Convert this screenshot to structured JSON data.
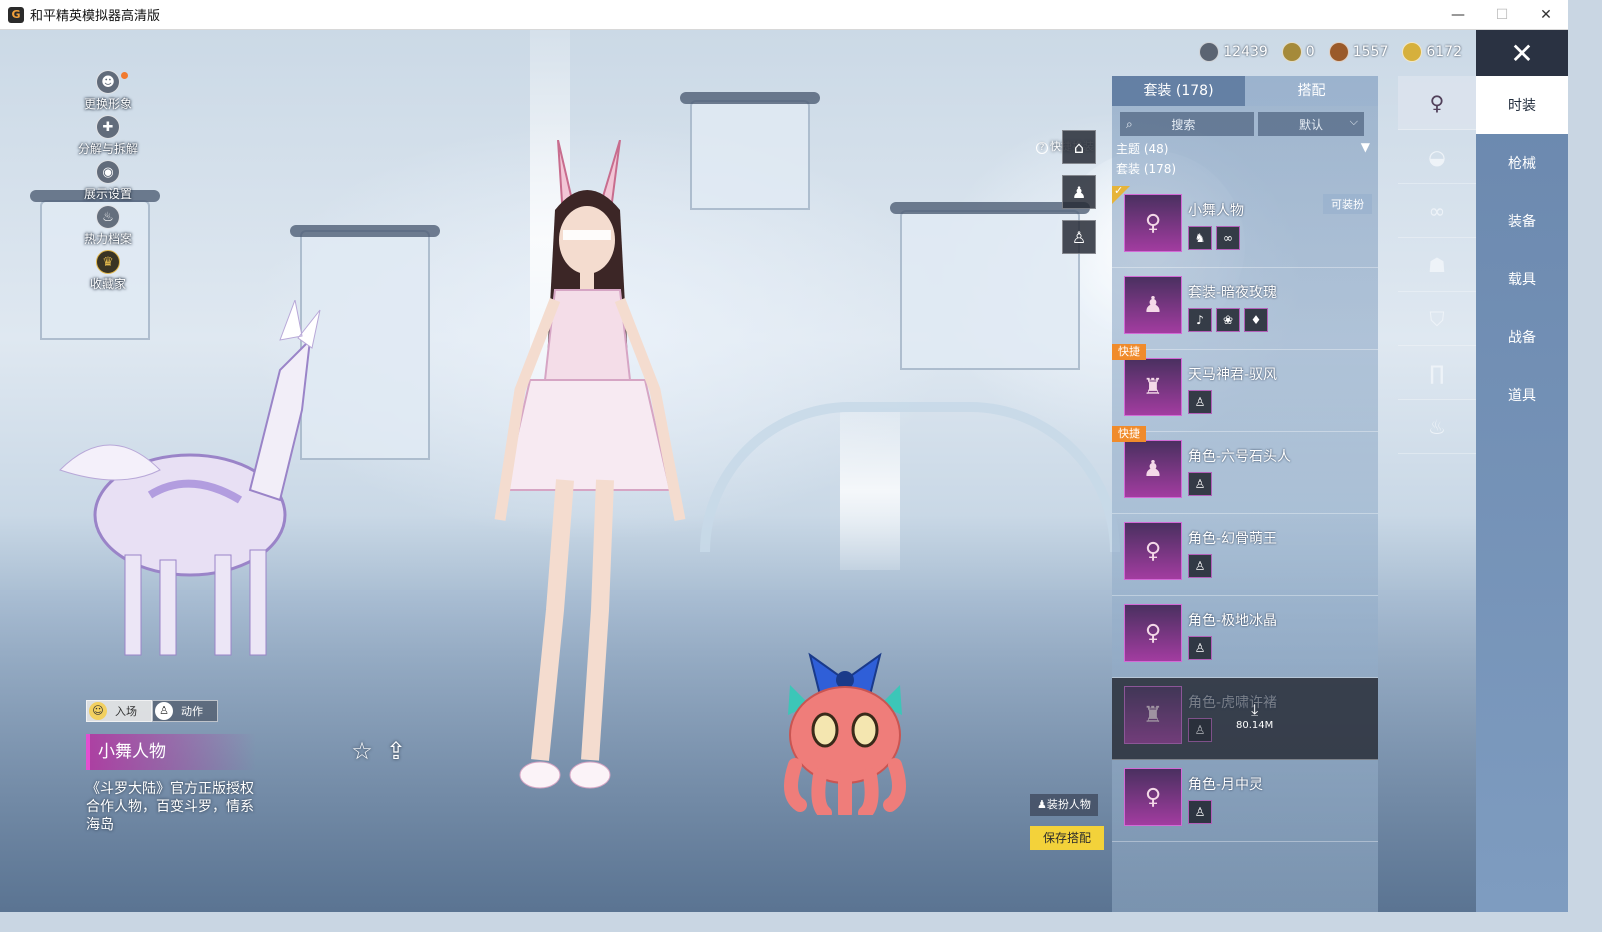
{
  "window": {
    "title": "和平精英模拟器高清版",
    "logo": "G",
    "minimize": "—",
    "maximize": "☐",
    "close": "✕"
  },
  "left_menu": [
    {
      "label": "更换形象",
      "icon": "avatar-icon",
      "glyph": "☻",
      "notify": true
    },
    {
      "label": "分解与拆解",
      "icon": "puzzle-icon",
      "glyph": "✚"
    },
    {
      "label": "展示设置",
      "icon": "eye-icon",
      "glyph": "◉"
    },
    {
      "label": "热力档案",
      "icon": "flame-icon",
      "glyph": "♨"
    },
    {
      "label": "收藏家",
      "icon": "collector-icon",
      "glyph": "♛",
      "gold": true
    }
  ],
  "emote_tabs": [
    {
      "label": "入场",
      "icon": "smile-icon",
      "glyph": "☺",
      "active": true
    },
    {
      "label": "动作",
      "icon": "pose-icon",
      "glyph": "♙",
      "active": false
    }
  ],
  "outfit": {
    "name": "小舞人物",
    "description": "《斗罗大陆》官方正版授权合作人物，百变斗罗，情系海岛",
    "favorite_icon": "star-outline-icon",
    "favorite_glyph": "☆",
    "share_icon": "share-icon",
    "share_glyph": "⇪"
  },
  "quick_swap": {
    "label": "快捷换装",
    "help_icon": "help-circle-icon",
    "help_glyph": "?",
    "slots": [
      {
        "icon": "hanger-icon",
        "glyph": "⌂"
      },
      {
        "icon": "outfit-slot-icon",
        "glyph": "♟"
      },
      {
        "icon": "outfit-slot-icon",
        "glyph": "♙"
      }
    ]
  },
  "currencies": [
    {
      "value": "12439",
      "icon": "silver-coin-icon",
      "color": "#5b6472"
    },
    {
      "value": "0",
      "icon": "gold-coin-icon",
      "color": "#a58a3a"
    },
    {
      "value": "1557",
      "icon": "bronze-coin-icon",
      "color": "#9a5a2a"
    },
    {
      "value": "6172",
      "icon": "star-coin-icon",
      "color": "#d6b03c"
    }
  ],
  "inventory": {
    "tabs": [
      {
        "label": "套装 (178)",
        "active": true
      },
      {
        "label": "搭配",
        "active": false
      }
    ],
    "search_placeholder": "搜索",
    "search_icon": "search-icon",
    "search_glyph": "⌕",
    "sort_label": "默认",
    "sort_chevron": "⌵",
    "categories": [
      {
        "label": "主题 (48)",
        "arrow": "▼"
      },
      {
        "label": "套装 (178)",
        "arrow": ""
      }
    ],
    "items": [
      {
        "name": "小舞人物",
        "thumb": "♀",
        "parts": [
          "♞",
          "∞"
        ],
        "equipped": true,
        "check": "✓",
        "wearable": "可装扮"
      },
      {
        "name": "套装-暗夜玫瑰",
        "thumb": "♟",
        "parts": [
          "♪",
          "❀",
          "♦"
        ]
      },
      {
        "name": "天马神君-驭风",
        "thumb": "♜",
        "parts": [
          "♙"
        ],
        "badge": "快捷"
      },
      {
        "name": "角色-六号石头人",
        "thumb": "♟",
        "parts": [
          "♙"
        ],
        "badge": "快捷"
      },
      {
        "name": "角色-幻骨萌王",
        "thumb": "♀",
        "parts": [
          "♙"
        ]
      },
      {
        "name": "角色-极地冰晶",
        "thumb": "♀",
        "parts": [
          "♙"
        ]
      },
      {
        "name": "角色-虎啸许褚",
        "thumb": "♜",
        "parts": [
          "♙"
        ],
        "locked": true,
        "download_size": "80.14M",
        "download_glyph": "⤓"
      },
      {
        "name": "角色-月中灵",
        "thumb": "♀",
        "parts": [
          "♙"
        ]
      }
    ]
  },
  "actions": {
    "wear_character": "装扮人物",
    "wear_icon": "♟",
    "save_outfit": "保存搭配"
  },
  "type_sidebar": [
    {
      "icon": "character-icon",
      "glyph": "♀",
      "active": true
    },
    {
      "icon": "cap-icon",
      "glyph": "◒"
    },
    {
      "icon": "glasses-icon",
      "glyph": "∞"
    },
    {
      "icon": "mask-icon",
      "glyph": "☗"
    },
    {
      "icon": "jacket-icon",
      "glyph": "⛉"
    },
    {
      "icon": "pants-icon",
      "glyph": "∏"
    },
    {
      "icon": "shoes-icon",
      "glyph": "♨"
    }
  ],
  "category_sidebar": {
    "close_glyph": "✕",
    "items": [
      {
        "label": "时装",
        "active": true
      },
      {
        "label": "枪械"
      },
      {
        "label": "装备"
      },
      {
        "label": "载具"
      },
      {
        "label": "战备"
      },
      {
        "label": "道具"
      }
    ]
  }
}
